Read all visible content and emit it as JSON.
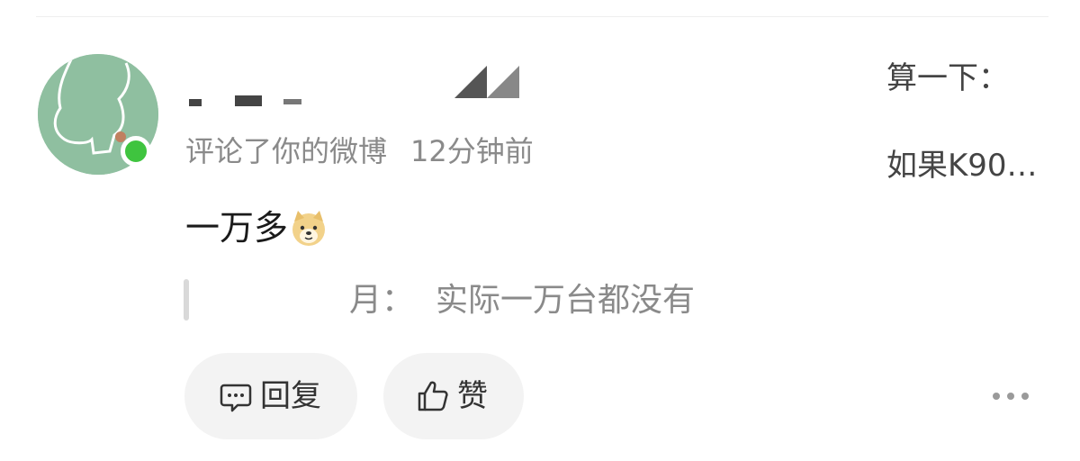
{
  "notification": {
    "action_text": "评论了你的微博",
    "time_text": "12分钟前",
    "comment_text": "一万多",
    "comment_emoji": "doge-emoji",
    "quote_prefix": "月：",
    "quote_text": "实际一万台都没有",
    "preview_line1": "算一下：",
    "preview_line2": "如果K90…"
  },
  "actions": {
    "reply_label": "回复",
    "like_label": "赞",
    "more_icon": "more-dots-icon"
  },
  "colors": {
    "online_dot": "#3fc43f",
    "button_bg": "#f3f3f3",
    "meta_text": "#8a8a8a",
    "avatar_bg": "#8fbfa0"
  }
}
